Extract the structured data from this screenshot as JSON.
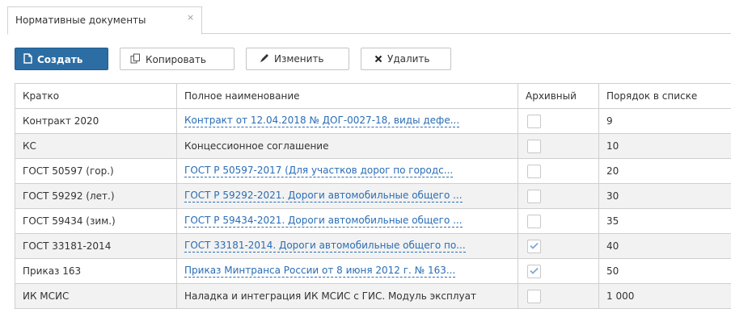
{
  "tab": {
    "title": "Нормативные документы",
    "close": "×"
  },
  "toolbar": {
    "create": "Создать",
    "copy": "Копировать",
    "edit": "Изменить",
    "delete": "Удалить"
  },
  "table": {
    "columns": [
      "Кратко",
      "Полное наименование",
      "Архивный",
      "Порядок в списке"
    ],
    "rows": [
      {
        "short": "Контракт 2020",
        "full": "Контракт от 12.04.2018 № ДОГ-0027-18, виды дефе...",
        "link": true,
        "archived": false,
        "order": "9"
      },
      {
        "short": "КС",
        "full": "Концессионное соглашение",
        "link": false,
        "archived": false,
        "order": "10"
      },
      {
        "short": "ГОСТ 50597 (гор.)",
        "full": "ГОСТ Р 50597-2017 (Для участков дорог по городс...",
        "link": true,
        "archived": false,
        "order": "20"
      },
      {
        "short": "ГОСТ 59292 (лет.)",
        "full": "ГОСТ Р 59292-2021. Дороги автомобильные общего ...",
        "link": true,
        "archived": false,
        "order": "30"
      },
      {
        "short": "ГОСТ 59434 (зим.)",
        "full": "ГОСТ Р 59434-2021. Дороги автомобильные общего ...",
        "link": true,
        "archived": false,
        "order": "35"
      },
      {
        "short": "ГОСТ 33181-2014",
        "full": "ГОСТ 33181-2014. Дороги автомобильные общего по...",
        "link": true,
        "archived": true,
        "order": "40"
      },
      {
        "short": "Приказ 163",
        "full": "Приказ Минтранса России от 8 июня 2012 г. № 163...",
        "link": true,
        "archived": true,
        "order": "50"
      },
      {
        "short": "ИК МСИС",
        "full": "Наладка и интеграция ИК МСИС с ГИС. Модуль эксплуат",
        "link": false,
        "archived": false,
        "order": "1 000"
      }
    ]
  },
  "icons": {
    "create": "document-icon",
    "copy": "copy-icon",
    "edit": "pencil-icon",
    "delete": "x-icon",
    "checked": "checkmark-icon"
  },
  "colors": {
    "primary": "#2c6ea4",
    "link": "#2a6db5",
    "stripe": "#f2f2f2"
  }
}
